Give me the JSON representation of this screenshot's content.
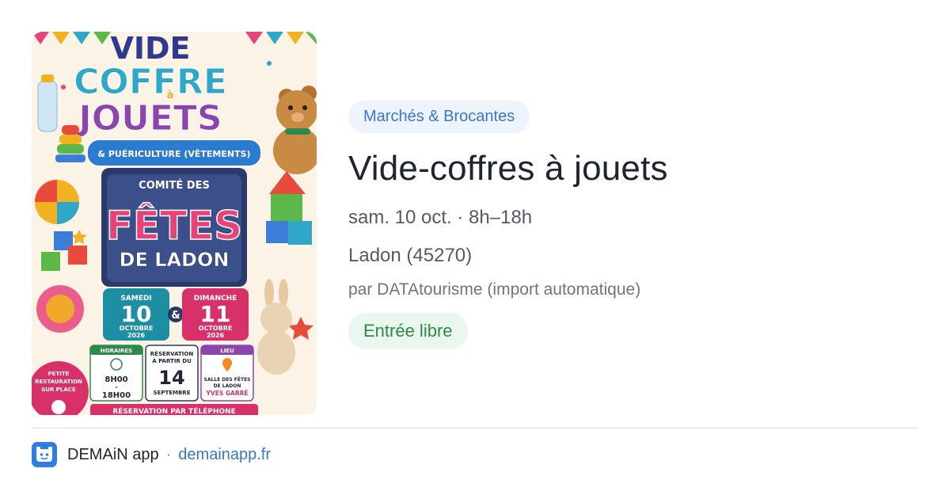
{
  "poster": {
    "title_lines": [
      "VIDE",
      "COFFRE",
      "à",
      "JOUETS"
    ],
    "subtitle": "& PUÉRICULTURE (VÊTEMENTS)",
    "comite": "COMITÉ DES",
    "fetes": "FÊTES",
    "ladon": "DE LADON",
    "day1": {
      "name": "SAMEDI",
      "num": "10",
      "month": "OCTOBRE",
      "year": "2026"
    },
    "amp": "&",
    "day2": {
      "name": "DIMANCHE",
      "num": "11",
      "month": "OCTOBRE",
      "year": "2026"
    },
    "horaires": {
      "head": "HORAIRES",
      "from": "8H00",
      "dash": "-",
      "to": "18H00"
    },
    "reservation": {
      "head": "RÉSERVATION",
      "sub": "À PARTIR DU",
      "num": "14",
      "month": "SEPTEMBRE"
    },
    "lieu": {
      "head": "LIEU",
      "line1": "SALLE DES FÊTES",
      "line2": "DE LADON",
      "line3": "YVES GARRÉ"
    },
    "restauration": [
      "PETITE",
      "RESTAURATION",
      "SUR PLACE"
    ],
    "bottom": "RÉSERVATION PAR TÉLÉPHONE"
  },
  "event": {
    "category": "Marchés & Brocantes",
    "title": "Vide-coffres à jouets",
    "datetime": "sam. 10 oct. · 8h–18h",
    "location": "Ladon (45270)",
    "organizer": "par DATAtourisme (import automatique)",
    "price": "Entrée libre"
  },
  "footer": {
    "app_name": "DEMAiN app",
    "separator": "·",
    "link": "demainapp.fr",
    "icon": "app-logo-icon"
  },
  "colors": {
    "category_bg": "#eef4fd",
    "category_text": "#3a76c9",
    "price_bg": "#eaf7ee",
    "price_text": "#2d8a4a",
    "accent": "#2f7de1"
  }
}
